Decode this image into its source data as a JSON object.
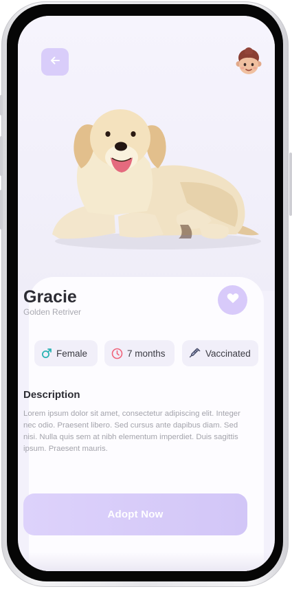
{
  "header": {
    "back_icon": "arrow-left-icon",
    "avatar_icon": "user-avatar-icon"
  },
  "pet": {
    "name": "Gracie",
    "breed": "Golden Retriver",
    "favorite_icon": "heart-icon"
  },
  "attributes": [
    {
      "label": "Female",
      "icon": "male-symbol-icon",
      "color": "#2bb3b3"
    },
    {
      "label": "7 months",
      "icon": "clock-icon",
      "color": "#f0637a"
    },
    {
      "label": "Vaccinated",
      "icon": "syringe-icon",
      "color": "#4a4f6a"
    }
  ],
  "description": {
    "title": "Description",
    "text": "Lorem ipsum dolor sit amet, consectetur adipiscing elit. Integer nec odio. Praesent libero. Sed cursus ante dapibus diam. Sed nisi. Nulla quis sem at nibh elementum imperdiet. Duis sagittis ipsum. Praesent mauris."
  },
  "actions": {
    "adopt_label": "Adopt Now"
  },
  "colors": {
    "accent": "#d8cafa",
    "background": "#f3f1fb",
    "card": "#fdfcff"
  }
}
